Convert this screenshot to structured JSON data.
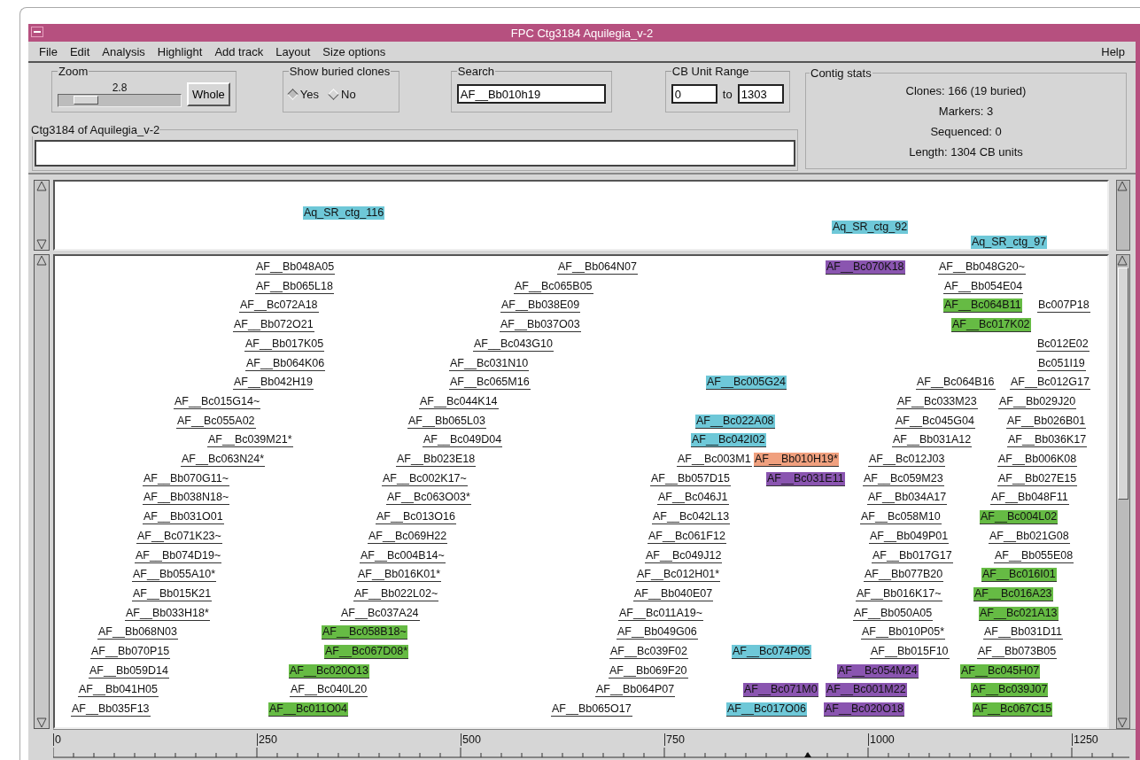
{
  "window": {
    "title": "FPC Ctg3184 Aquilegia_v-2"
  },
  "menu": [
    "File",
    "Edit",
    "Analysis",
    "Highlight",
    "Add track",
    "Layout",
    "Size options"
  ],
  "help": "Help",
  "zoom": {
    "label": "Zoom",
    "value": "2.8",
    "level": 0.15,
    "button": "Whole"
  },
  "buried": {
    "label": "Show buried clones",
    "options": [
      {
        "label": "Yes",
        "selected": true
      },
      {
        "label": "No",
        "selected": false
      }
    ]
  },
  "search": {
    "label": "Search",
    "value": "AF__Bb010h19"
  },
  "range": {
    "label": "CB Unit Range",
    "from": "0",
    "to_label": "to",
    "to": "1303"
  },
  "contig": {
    "label": "Ctg3184 of Aquilegia_v-2"
  },
  "stats": {
    "label": "Contig stats",
    "lines": [
      "Clones: 166 (19 buried)",
      "Markers: 3",
      "Sequenced: 0",
      "Length: 1304 CB units"
    ]
  },
  "markers": [
    {
      "name": "Aq_SR_ctg_116"
    },
    {
      "name": "Aq_SR_ctg_92"
    },
    {
      "name": "Aq_SR_ctg_97"
    }
  ],
  "clone_rows": [
    {
      "clones": [
        {
          "name": "AF__Bb048A05"
        },
        {
          "name": "AF__Bb064N07"
        },
        {
          "name": "AF__Bc070K18",
          "color": "#8a55b0"
        },
        {
          "name": "AF__Bb048G20~"
        }
      ]
    },
    {
      "clones": [
        {
          "name": "AF__Bb065L18"
        },
        {
          "name": "AF__Bc065B05"
        },
        {
          "name": "AF__Bb054E04"
        }
      ]
    },
    {
      "clones": [
        {
          "name": "AF__Bc072A18"
        },
        {
          "name": "AF__Bb038E09"
        },
        {
          "name": "AF__Bc064B11",
          "color": "#66bb44"
        },
        {
          "name": "Bc007P18"
        }
      ]
    },
    {
      "clones": [
        {
          "name": "AF__Bb072O21"
        },
        {
          "name": "AF__Bb037O03"
        },
        {
          "name": "AF__Bc017K02",
          "color": "#66bb44"
        }
      ]
    },
    {
      "clones": [
        {
          "name": "AF__Bb017K05"
        },
        {
          "name": "AF__Bc043G10"
        },
        {
          "name": "Bc012E02"
        }
      ]
    },
    {
      "clones": [
        {
          "name": "AF__Bb064K06"
        },
        {
          "name": "AF__Bc031N10"
        },
        {
          "name": "Bc051I19"
        }
      ]
    },
    {
      "clones": [
        {
          "name": "AF__Bb042H19"
        },
        {
          "name": "AF__Bc065M16"
        },
        {
          "name": "AF__Bc005G24",
          "color": "#6ec8d8"
        },
        {
          "name": "AF__Bc064B16"
        },
        {
          "name": "AF__Bc012G17"
        }
      ]
    },
    {
      "clones": [
        {
          "name": "AF__Bc015G14~"
        },
        {
          "name": "AF__Bc044K14"
        },
        {
          "name": "AF__Bc033M23"
        },
        {
          "name": "AF__Bb029J20"
        }
      ]
    },
    {
      "clones": [
        {
          "name": "AF__Bc055A02"
        },
        {
          "name": "AF__Bb065L03"
        },
        {
          "name": "AF__Bc022A08",
          "color": "#6ec8d8"
        },
        {
          "name": "AF__Bc045G04"
        },
        {
          "name": "AF__Bb026B01"
        }
      ]
    },
    {
      "clones": [
        {
          "name": "AF__Bc039M21*"
        },
        {
          "name": "AF__Bc049D04"
        },
        {
          "name": "AF__Bc042I02",
          "color": "#6ec8d8"
        },
        {
          "name": "AF__Bb031A12"
        },
        {
          "name": "AF__Bb036K17"
        }
      ]
    },
    {
      "clones": [
        {
          "name": "AF__Bc063N24*"
        },
        {
          "name": "AF__Bb023E18"
        },
        {
          "name": "AF__Bc003M1"
        },
        {
          "name": "AF__Bb010H19*",
          "color": "#f0a07e"
        },
        {
          "name": "AF__Bc012J03"
        },
        {
          "name": "AF__Bb006K08"
        }
      ]
    },
    {
      "clones": [
        {
          "name": "AF__Bb070G11~"
        },
        {
          "name": "AF__Bc002K17~"
        },
        {
          "name": "AF__Bb057D15"
        },
        {
          "name": "AF__Bc031E11",
          "color": "#8a55b0"
        },
        {
          "name": "AF__Bc059M23"
        },
        {
          "name": "AF__Bb027E15"
        }
      ]
    },
    {
      "clones": [
        {
          "name": "AF__Bb038N18~"
        },
        {
          "name": "AF__Bc063O03*"
        },
        {
          "name": "AF__Bc046J1"
        },
        {
          "name": "AF__Bb034A17"
        },
        {
          "name": "AF__Bb048F11"
        }
      ]
    },
    {
      "clones": [
        {
          "name": "AF__Bb031O01"
        },
        {
          "name": "AF__Bc013O16"
        },
        {
          "name": "AF__Bc042L13"
        },
        {
          "name": "AF__Bc058M10"
        },
        {
          "name": "AF__Bc004L02",
          "color": "#66bb44"
        }
      ]
    },
    {
      "clones": [
        {
          "name": "AF__Bc071K23~"
        },
        {
          "name": "AF__Bc069H22"
        },
        {
          "name": "AF__Bc061F12"
        },
        {
          "name": "AF__Bb049P01"
        },
        {
          "name": "AF__Bb021G08"
        }
      ]
    },
    {
      "clones": [
        {
          "name": "AF__Bb074D19~"
        },
        {
          "name": "AF__Bc004B14~"
        },
        {
          "name": "AF__Bc049J12"
        },
        {
          "name": "AF__Bb017G17"
        },
        {
          "name": "AF__Bb055E08"
        }
      ]
    },
    {
      "clones": [
        {
          "name": "AF__Bb055A10*"
        },
        {
          "name": "AF__Bb016K01*"
        },
        {
          "name": "AF__Bc012H01*"
        },
        {
          "name": "AF__Bb077B20"
        },
        {
          "name": "AF__Bc016I01",
          "color": "#66bb44"
        }
      ]
    },
    {
      "clones": [
        {
          "name": "AF__Bb015K21"
        },
        {
          "name": "AF__Bb022L02~"
        },
        {
          "name": "AF__Bb040E07"
        },
        {
          "name": "AF__Bb016K17~"
        },
        {
          "name": "AF__Bc016A23",
          "color": "#66bb44"
        }
      ]
    },
    {
      "clones": [
        {
          "name": "AF__Bb033H18*"
        },
        {
          "name": "AF__Bc037A24"
        },
        {
          "name": "AF__Bc011A19~"
        },
        {
          "name": "AF__Bb050A05"
        },
        {
          "name": "AF__Bc021A13",
          "color": "#66bb44"
        }
      ]
    },
    {
      "clones": [
        {
          "name": "AF__Bb068N03"
        },
        {
          "name": "AF__Bc058B18~",
          "color": "#66bb44"
        },
        {
          "name": "AF__Bb049G06"
        },
        {
          "name": "AF__Bb010P05*"
        },
        {
          "name": "AF__Bb031D11"
        }
      ]
    },
    {
      "clones": [
        {
          "name": "AF__Bb070P15"
        },
        {
          "name": "AF__Bc067D08*",
          "color": "#66bb44"
        },
        {
          "name": "AF__Bc039F02"
        },
        {
          "name": "AF__Bc074P05",
          "color": "#6ec8d8"
        },
        {
          "name": "AF__Bb015F10"
        },
        {
          "name": "AF__Bb073B05"
        }
      ]
    },
    {
      "clones": [
        {
          "name": "AF__Bb059D14"
        },
        {
          "name": "AF__Bc020O13",
          "color": "#66bb44"
        },
        {
          "name": "AF__Bb069F20"
        },
        {
          "name": "AF__Bc054M24",
          "color": "#8a55b0"
        },
        {
          "name": "AF__Bc045H07",
          "color": "#66bb44"
        }
      ]
    },
    {
      "clones": [
        {
          "name": "AF__Bb041H05"
        },
        {
          "name": "AF__Bc040L20"
        },
        {
          "name": "AF__Bb064P07"
        },
        {
          "name": "AF__Bc071M0",
          "color": "#8a55b0"
        },
        {
          "name": "AF__Bc001M22",
          "color": "#8a55b0"
        },
        {
          "name": "AF__Bc039J07",
          "color": "#66bb44"
        }
      ]
    },
    {
      "clones": [
        {
          "name": "AF__Bb035F13"
        },
        {
          "name": "AF__Bc011O04",
          "color": "#66bb44"
        },
        {
          "name": "AF__Bb065O17"
        },
        {
          "name": "AF__Bc017O06",
          "color": "#6ec8d8"
        },
        {
          "name": "AF__Bc020O18",
          "color": "#8a55b0"
        },
        {
          "name": "AF__Bc067C15",
          "color": "#66bb44"
        }
      ]
    }
  ],
  "ruler": {
    "ticks": [
      "0",
      "250",
      "500",
      "750",
      "1000",
      "1250"
    ]
  }
}
